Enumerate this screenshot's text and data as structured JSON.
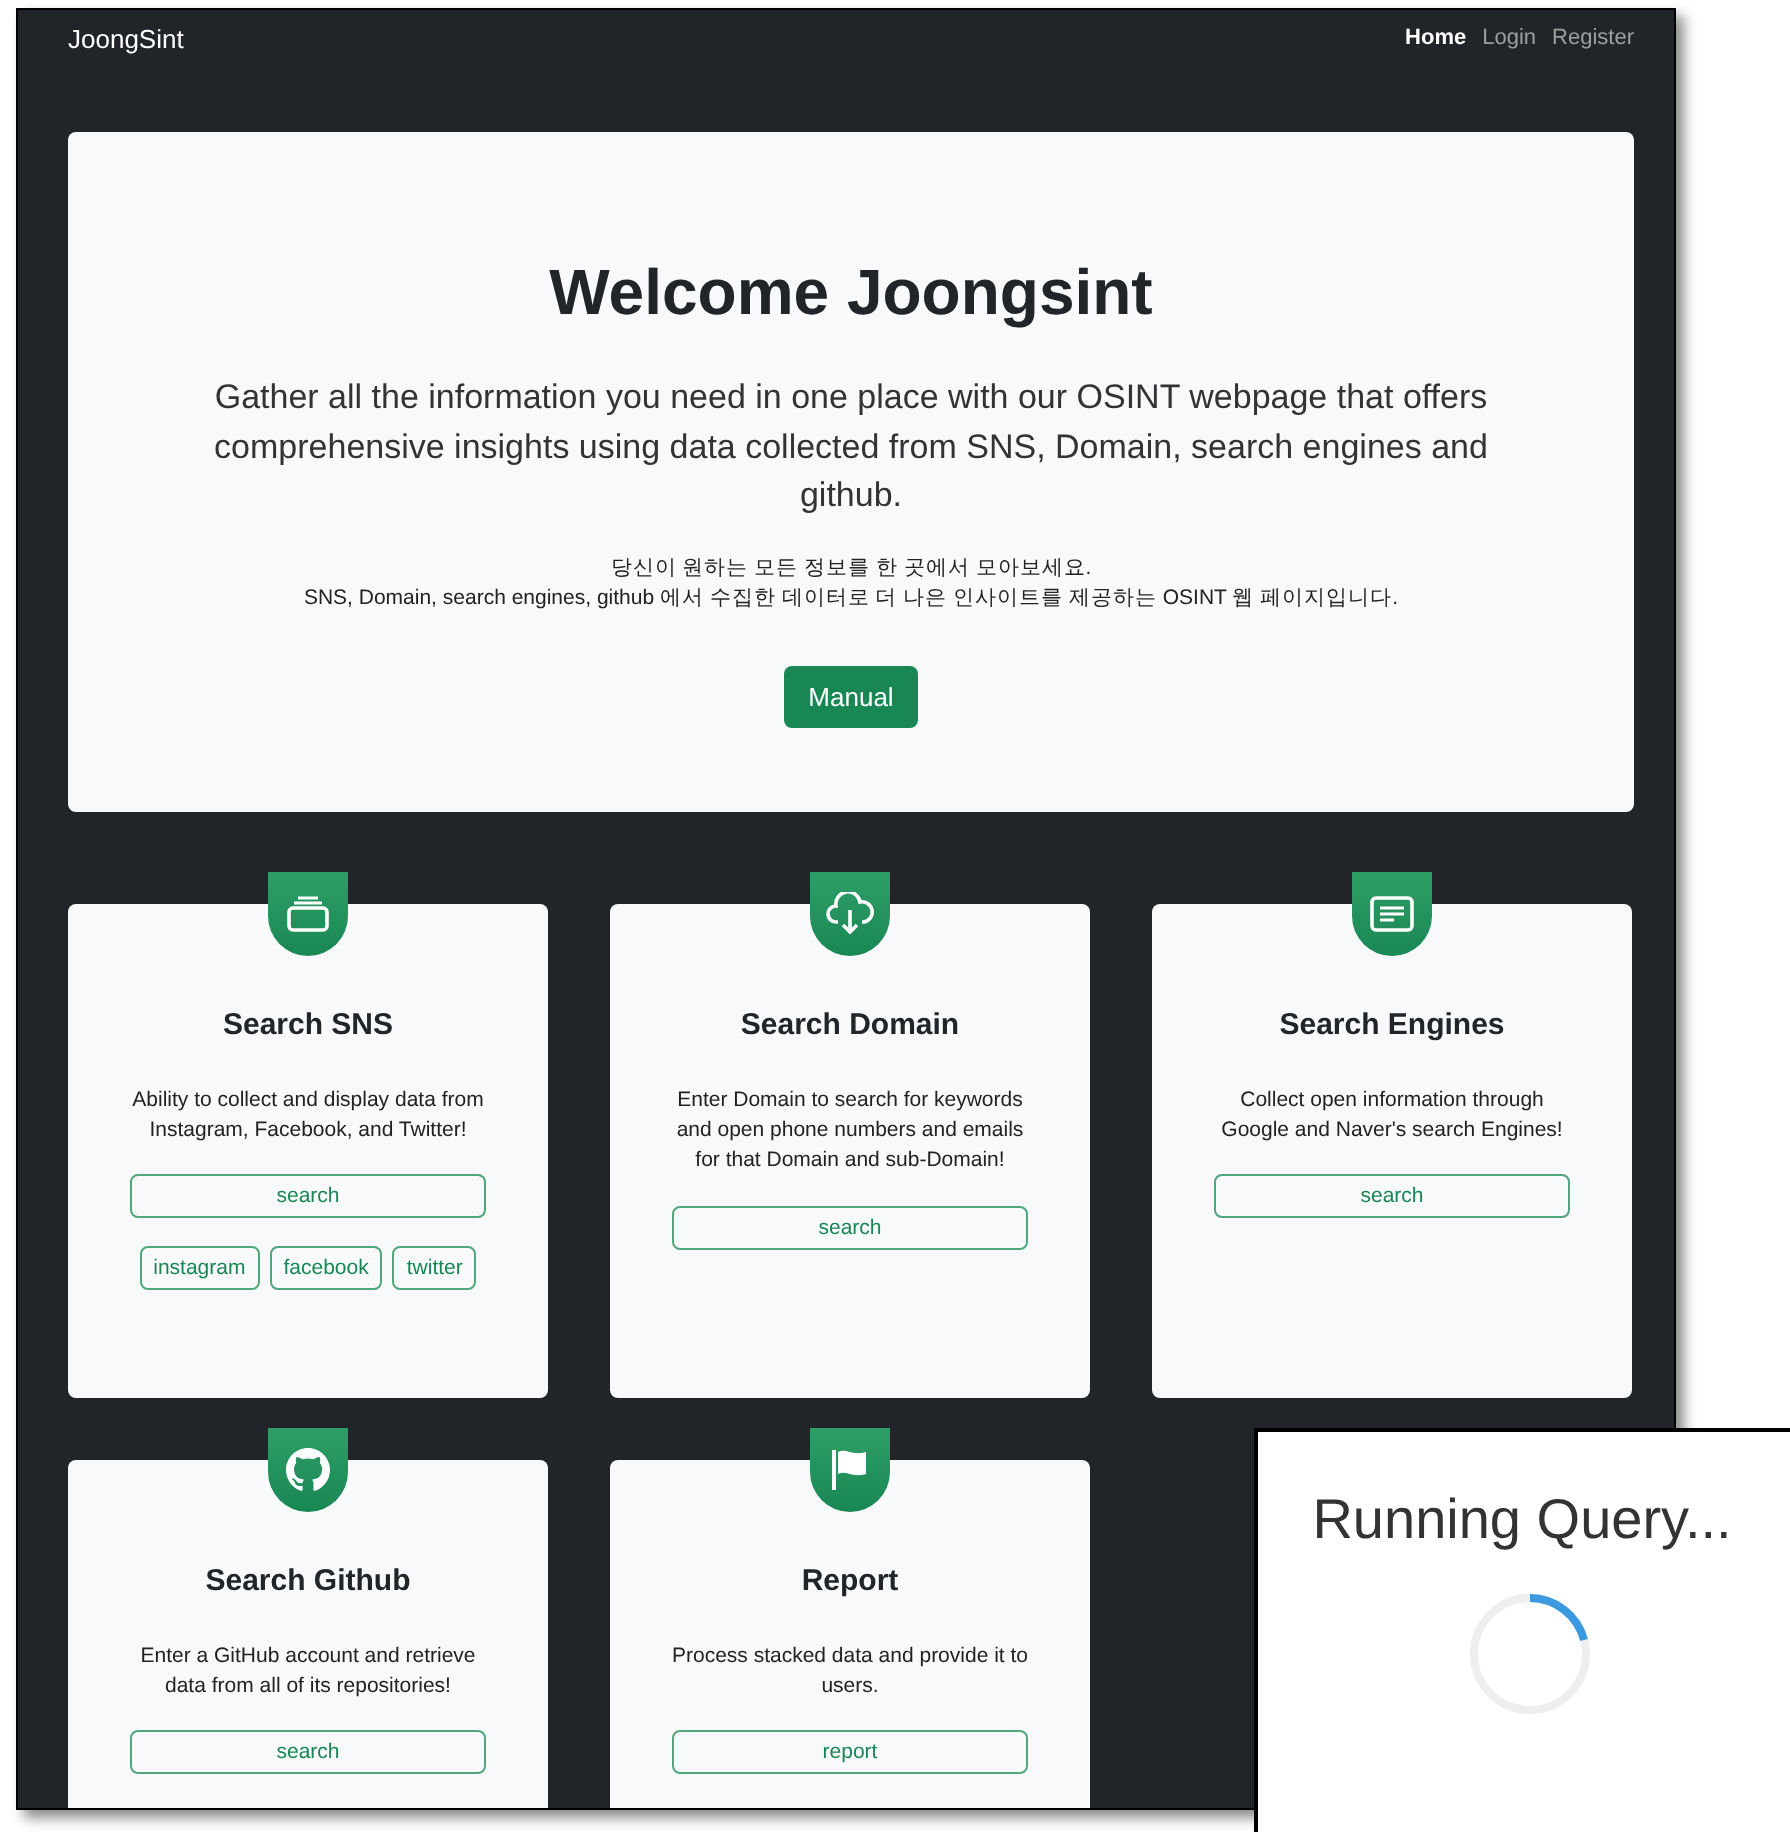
{
  "navbar": {
    "brand": "JoongSint",
    "links": [
      {
        "label": "Home",
        "selected": true
      },
      {
        "label": "Login",
        "selected": false
      },
      {
        "label": "Register",
        "selected": false
      }
    ]
  },
  "hero": {
    "title": "Welcome Joongsint",
    "lead": "Gather all the information you need in one place with our OSINT webpage that offers comprehensive insights using data collected from SNS, Domain, search engines and github.",
    "korean_lines": [
      "당신이 원하는 모든 정보를 한 곳에서 모아보세요.",
      "SNS, Domain, search engines, github 에서 수집한 데이터로 더 나은 인사이트를 제공하는 OSINT 웹 페이지입니다."
    ],
    "button": "Manual"
  },
  "cards": [
    {
      "kind": "sns",
      "title": "Search SNS",
      "description": "Ability to collect and display data from Instagram, Facebook, and Twitter!",
      "button": "search",
      "tags": [
        "instagram",
        "facebook",
        "twitter"
      ]
    },
    {
      "kind": "domain",
      "title": "Search Domain",
      "description": "Enter Domain to search for keywords and open phone numbers and emails for that Domain and sub-Domain!",
      "button": "search"
    },
    {
      "kind": "engines",
      "title": "Search Engines",
      "description": "Collect open information through Google and Naver's search Engines!",
      "button": "search"
    },
    {
      "kind": "github",
      "title": "Search Github",
      "description": "Enter a GitHub account and retrieve data from all of its repositories!",
      "button": "search"
    },
    {
      "kind": "report",
      "title": "Report",
      "description": "Process stacked data and provide it to users.",
      "button": "report"
    }
  ],
  "dialog": {
    "title": "Running Query..."
  }
}
